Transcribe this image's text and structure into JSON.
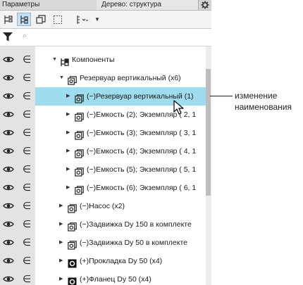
{
  "tabs": {
    "params": "Параметры",
    "tree": "Дерево: структура"
  },
  "icons": {
    "gear": "gear-icon",
    "filter": "filter-icon",
    "search": "search-icon",
    "eye": "eye-icon",
    "include": "include-icon"
  },
  "toolbar": {
    "dropdown_glyph": "▼"
  },
  "filter": {
    "search_glyph": "⌕"
  },
  "tree": {
    "rows": [
      {
        "label": "Компоненты",
        "level": 0,
        "arrow": "▼",
        "icon": "components"
      },
      {
        "label": "Резервуар вертикальный (х6)",
        "level": 1,
        "arrow": "▼",
        "icon": "assembly"
      },
      {
        "label": "(−)Резервуар вертикальный (1)",
        "level": 2,
        "arrow": "▶",
        "icon": "part",
        "selected": true
      },
      {
        "label": "(−)Емкость (2); Экземпляр ( 2, 1",
        "level": 2,
        "arrow": "▶",
        "icon": "part"
      },
      {
        "label": "(−)Емкость (3); Экземпляр ( 3, 1",
        "level": 2,
        "arrow": "▶",
        "icon": "part"
      },
      {
        "label": "(−)Емкость (4); Экземпляр ( 4, 1",
        "level": 2,
        "arrow": "▶",
        "icon": "part"
      },
      {
        "label": "(−)Емкость (5); Экземпляр ( 5, 1",
        "level": 2,
        "arrow": "▶",
        "icon": "part"
      },
      {
        "label": "(−)Емкость (6); Экземпляр ( 6, 1",
        "level": 2,
        "arrow": "▶",
        "icon": "part"
      },
      {
        "label": "(−)Насос (х2)",
        "level": 1,
        "arrow": "▶",
        "icon": "part"
      },
      {
        "label": "(−)Задвижка Dy 150 в комплекте",
        "level": 1,
        "arrow": "▶",
        "icon": "part"
      },
      {
        "label": "(−)Задвижка Dy 50 в комплекте",
        "level": 1,
        "arrow": "▶",
        "icon": "part"
      },
      {
        "label": "(+)Прокладка Dy 50 (х4)",
        "level": 1,
        "arrow": "▶",
        "icon": "part-solid"
      },
      {
        "label": "(+)Фланец Dy 50 (х4)",
        "level": 1,
        "arrow": "▶",
        "icon": "part-solid"
      }
    ]
  },
  "callout": {
    "line1": "изменение",
    "line2": "наименования"
  },
  "colors": {
    "selected_row": "#9fdced",
    "left_column": "#e3e3e3",
    "toolbar_active": "#c7dff3"
  }
}
